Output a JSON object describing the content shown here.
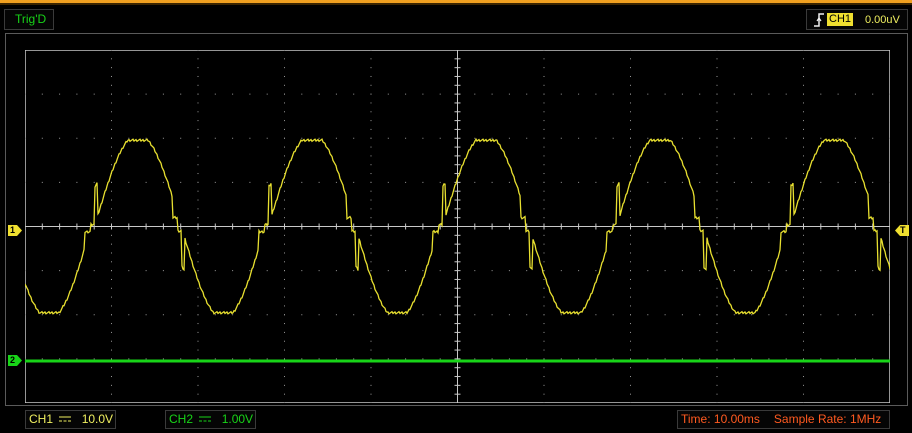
{
  "header": {
    "trigger_status": "Trig'D",
    "trigger_source": "CH1",
    "trigger_level": "0.00uV"
  },
  "markers": {
    "ch1": "1",
    "ch2": "2",
    "trigger": "T"
  },
  "status_bar": {
    "ch1_label": "CH1",
    "ch1_scale": "10.0V",
    "ch2_label": "CH2",
    "ch2_scale": "1.00V",
    "time": "Time: 10.00ms",
    "sample_rate": "Sample Rate: 1MHz"
  },
  "colors": {
    "ch1": "#f0e030",
    "ch2": "#18d418",
    "status_time": "#ff5a20",
    "trigger_strip": "#f0a020"
  }
}
